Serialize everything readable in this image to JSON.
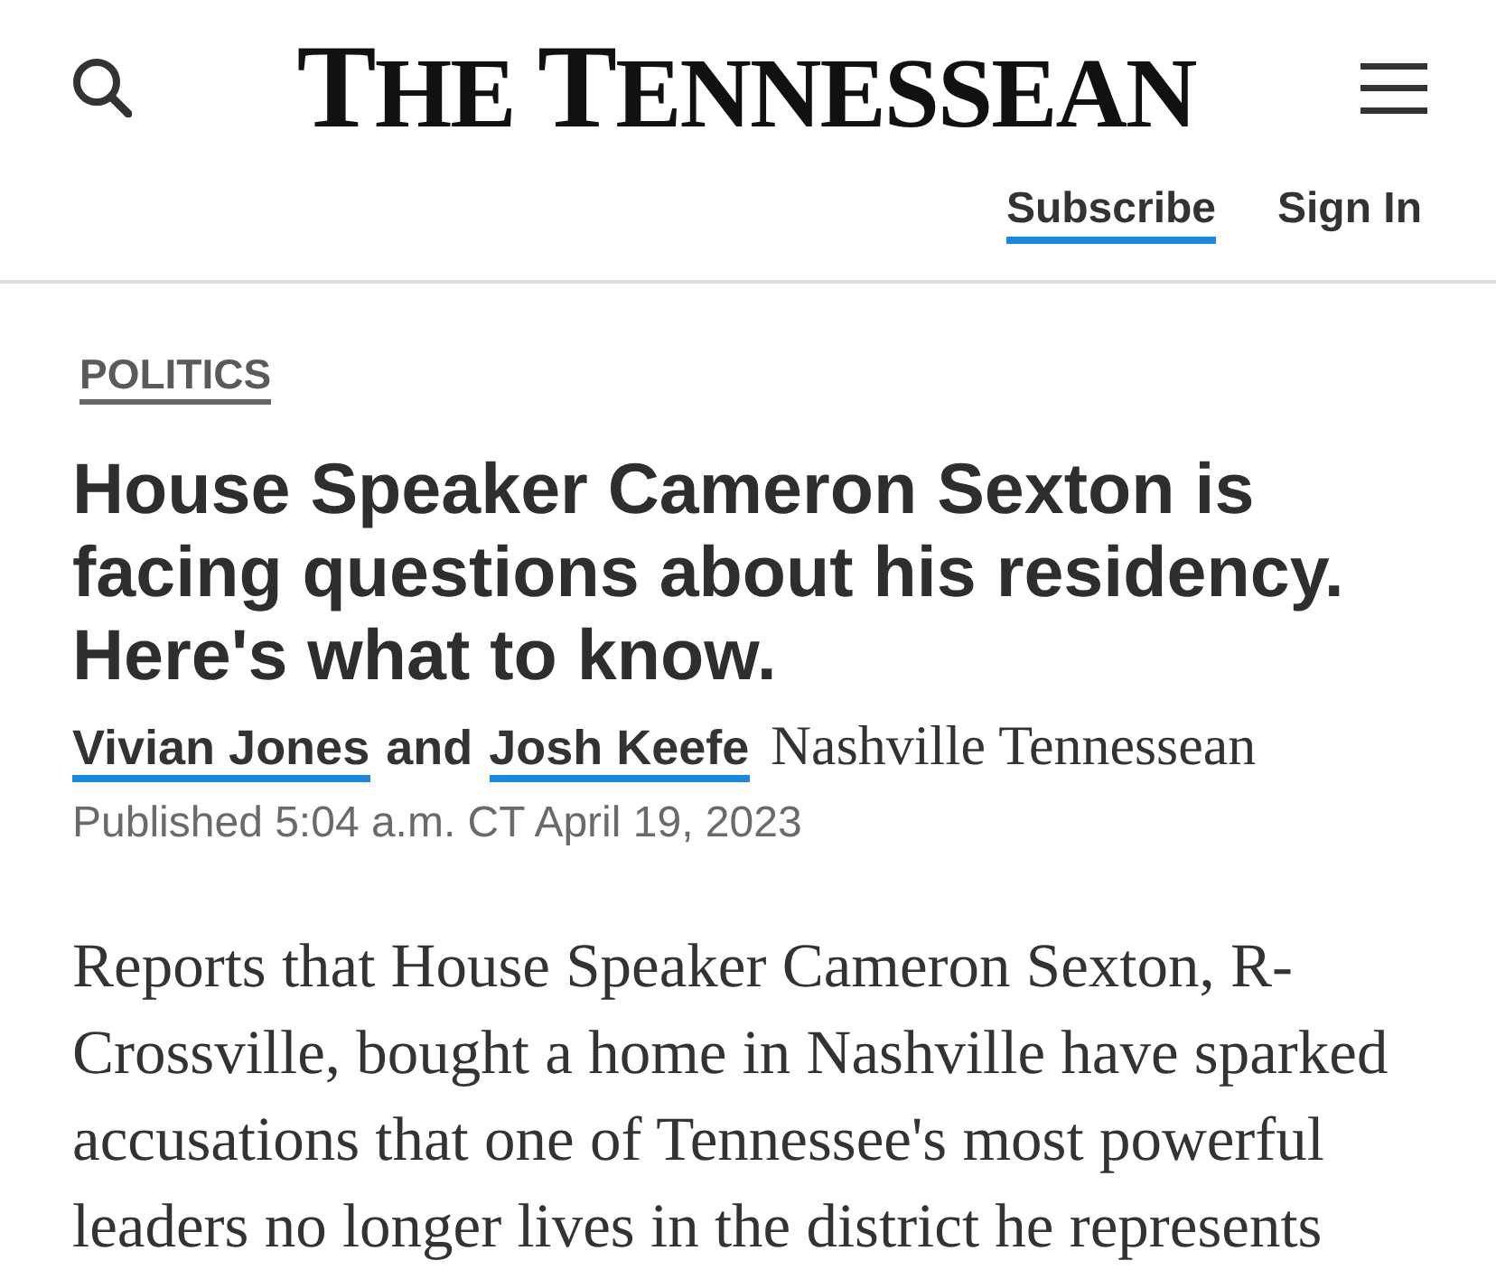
{
  "header": {
    "logo": "THE TENNESSEAN",
    "links": [
      {
        "label": "Subscribe",
        "highlighted": true
      },
      {
        "label": "Sign In",
        "highlighted": false
      }
    ]
  },
  "article": {
    "section": "POLITICS",
    "headline": "House Speaker Cameron Sexton is facing questions about his residency. Here's what to know.",
    "byline": {
      "authors": [
        "Vivian Jones",
        "Josh Keefe"
      ],
      "conjunction": "and",
      "source": "Nashville Tennessean"
    },
    "published": "Published 5:04 a.m. CT April 19, 2023",
    "body": [
      "Reports that House Speaker Cameron Sexton, R-Crossville, bought a home in Nashville have sparked accusations that one of Tennessee's most powerful leaders no longer lives in the district he represents"
    ]
  }
}
